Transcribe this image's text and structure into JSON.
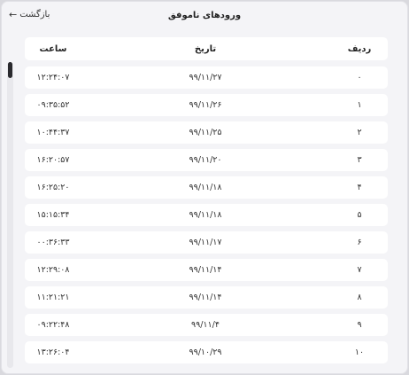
{
  "header": {
    "title": "ورودهای ناموفق",
    "back_label": "بازگشت",
    "back_icon": "arrow-left-icon"
  },
  "table": {
    "columns": {
      "time": "ساعت",
      "date": "تاریخ",
      "index": "ردیف"
    },
    "rows": [
      {
        "index": "۰",
        "date": "۹۹/۱۱/۲۷",
        "time": "۱۲:۲۴:۰۷"
      },
      {
        "index": "۱",
        "date": "۹۹/۱۱/۲۶",
        "time": "۰۹:۳۵:۵۲"
      },
      {
        "index": "۲",
        "date": "۹۹/۱۱/۲۵",
        "time": "۱۰:۴۴:۳۷"
      },
      {
        "index": "۳",
        "date": "۹۹/۱۱/۲۰",
        "time": "۱۶:۲۰:۵۷"
      },
      {
        "index": "۴",
        "date": "۹۹/۱۱/۱۸",
        "time": "۱۶:۲۵:۲۰"
      },
      {
        "index": "۵",
        "date": "۹۹/۱۱/۱۸",
        "time": "۱۵:۱۵:۳۴"
      },
      {
        "index": "۶",
        "date": "۹۹/۱۱/۱۷",
        "time": "۰۰:۳۶:۳۳"
      },
      {
        "index": "۷",
        "date": "۹۹/۱۱/۱۴",
        "time": "۱۲:۲۹:۰۸"
      },
      {
        "index": "۸",
        "date": "۹۹/۱۱/۱۴",
        "time": "۱۱:۲۱:۲۱"
      },
      {
        "index": "۹",
        "date": "۹۹/۱۱/۴",
        "time": "۰۹:۲۲:۴۸"
      },
      {
        "index": "۱۰",
        "date": "۹۹/۱۰/۲۹",
        "time": "۱۳:۲۶:۰۴"
      }
    ]
  },
  "scroll": {
    "position": 0
  }
}
